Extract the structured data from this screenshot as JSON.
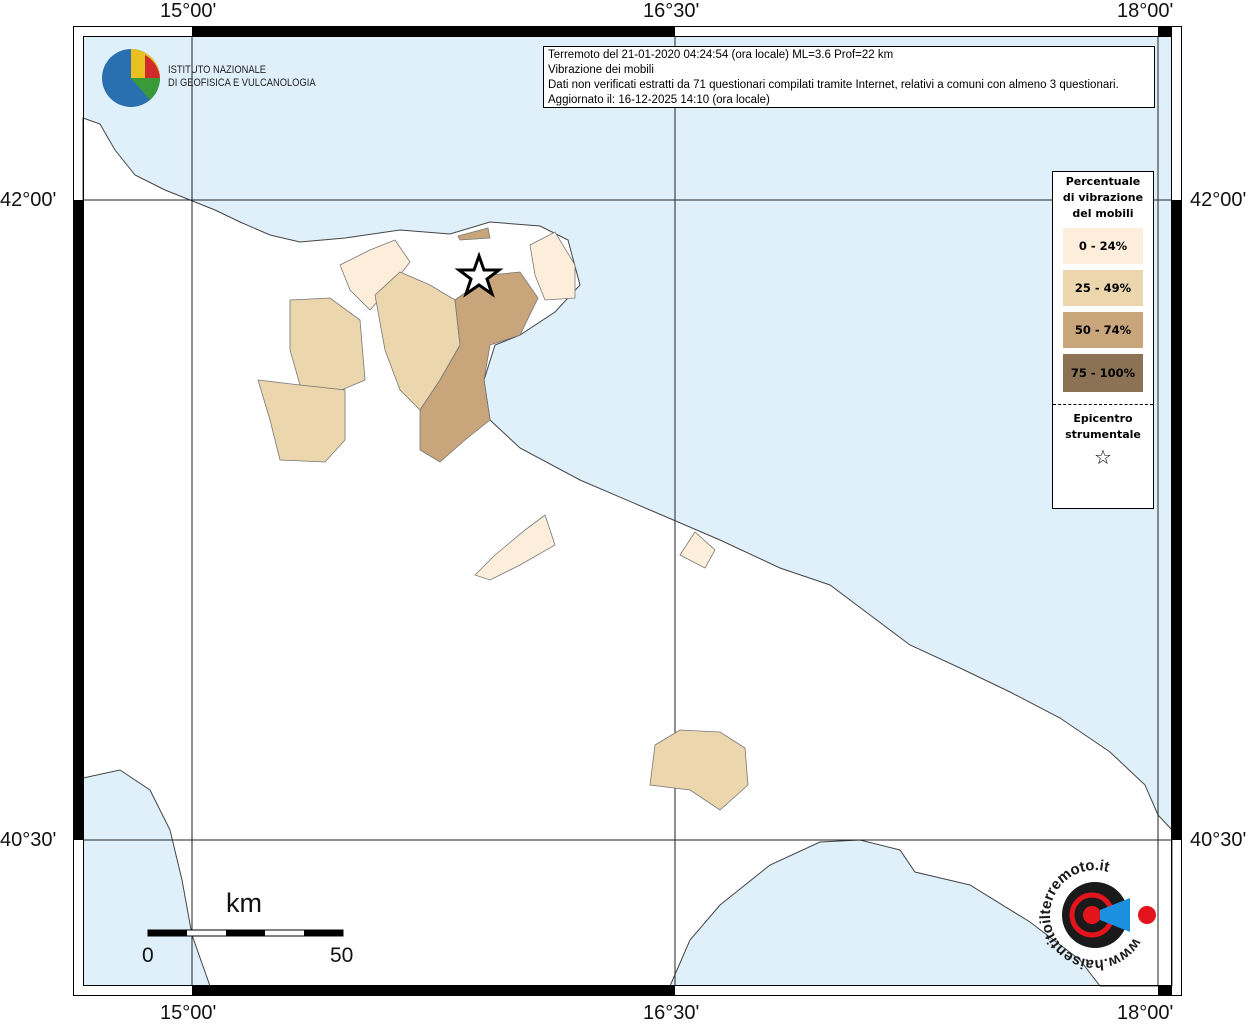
{
  "info": {
    "line1": "Terremoto del 21-01-2020 04:24:54 (ora locale) ML=3.6 Prof=22 km",
    "line2": "Vibrazione dei mobili",
    "line3": "Dati non verificati estratti da 71 questionari compilati tramite Internet, relativi a comuni con almeno 3 questionari.",
    "line4": "Aggiornato il: 16-12-2025 14:10 (ora locale)"
  },
  "logo": {
    "line1": "ISTITUTO NAZIONALE",
    "line2": "DI GEOFISICA E VULCANOLOGIA"
  },
  "axes": {
    "lon": [
      "15°00'",
      "16°30'",
      "18°00'"
    ],
    "lat": [
      "42°00'",
      "40°30'"
    ]
  },
  "legend": {
    "title": "Percentuale di vibrazione del mobili",
    "classes": [
      {
        "label": "0 - 24%",
        "color": "#fdeedb"
      },
      {
        "label": "25 - 49%",
        "color": "#ebd6ad"
      },
      {
        "label": "50 - 74%",
        "color": "#c8a57b"
      },
      {
        "label": "75 - 100%",
        "color": "#8b7254"
      }
    ],
    "epicenter_label": "Epicentro strumentale"
  },
  "scale": {
    "unit": "km",
    "min": "0",
    "max": "50"
  },
  "colors": {
    "sea": "#dff0fb",
    "land": "#ffffff"
  },
  "badge": {
    "text": "www.haisentitoilterremoto.it"
  }
}
